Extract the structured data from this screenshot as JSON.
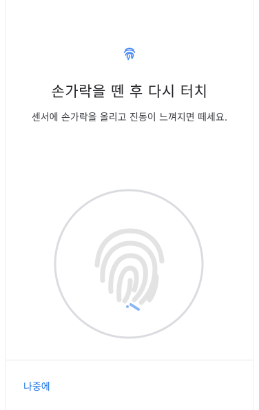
{
  "header": {
    "icon": "fingerprint-icon",
    "title": "손가락을 뗀 후 다시 터치",
    "instruction": "센서에 손가락을 올리고 진동이 느껴지면 떼세요."
  },
  "illustration": {
    "icon": "fingerprint-icon",
    "enroll_progress_indicator": "partial"
  },
  "footer": {
    "later_label": "나중에"
  },
  "colors": {
    "accent": "#1a73e8",
    "icon_accent": "#4285f4",
    "ring": "#dadce0",
    "fingerprint_gray": "#e3e3e3",
    "progress_blue": "#8ab4f8"
  }
}
